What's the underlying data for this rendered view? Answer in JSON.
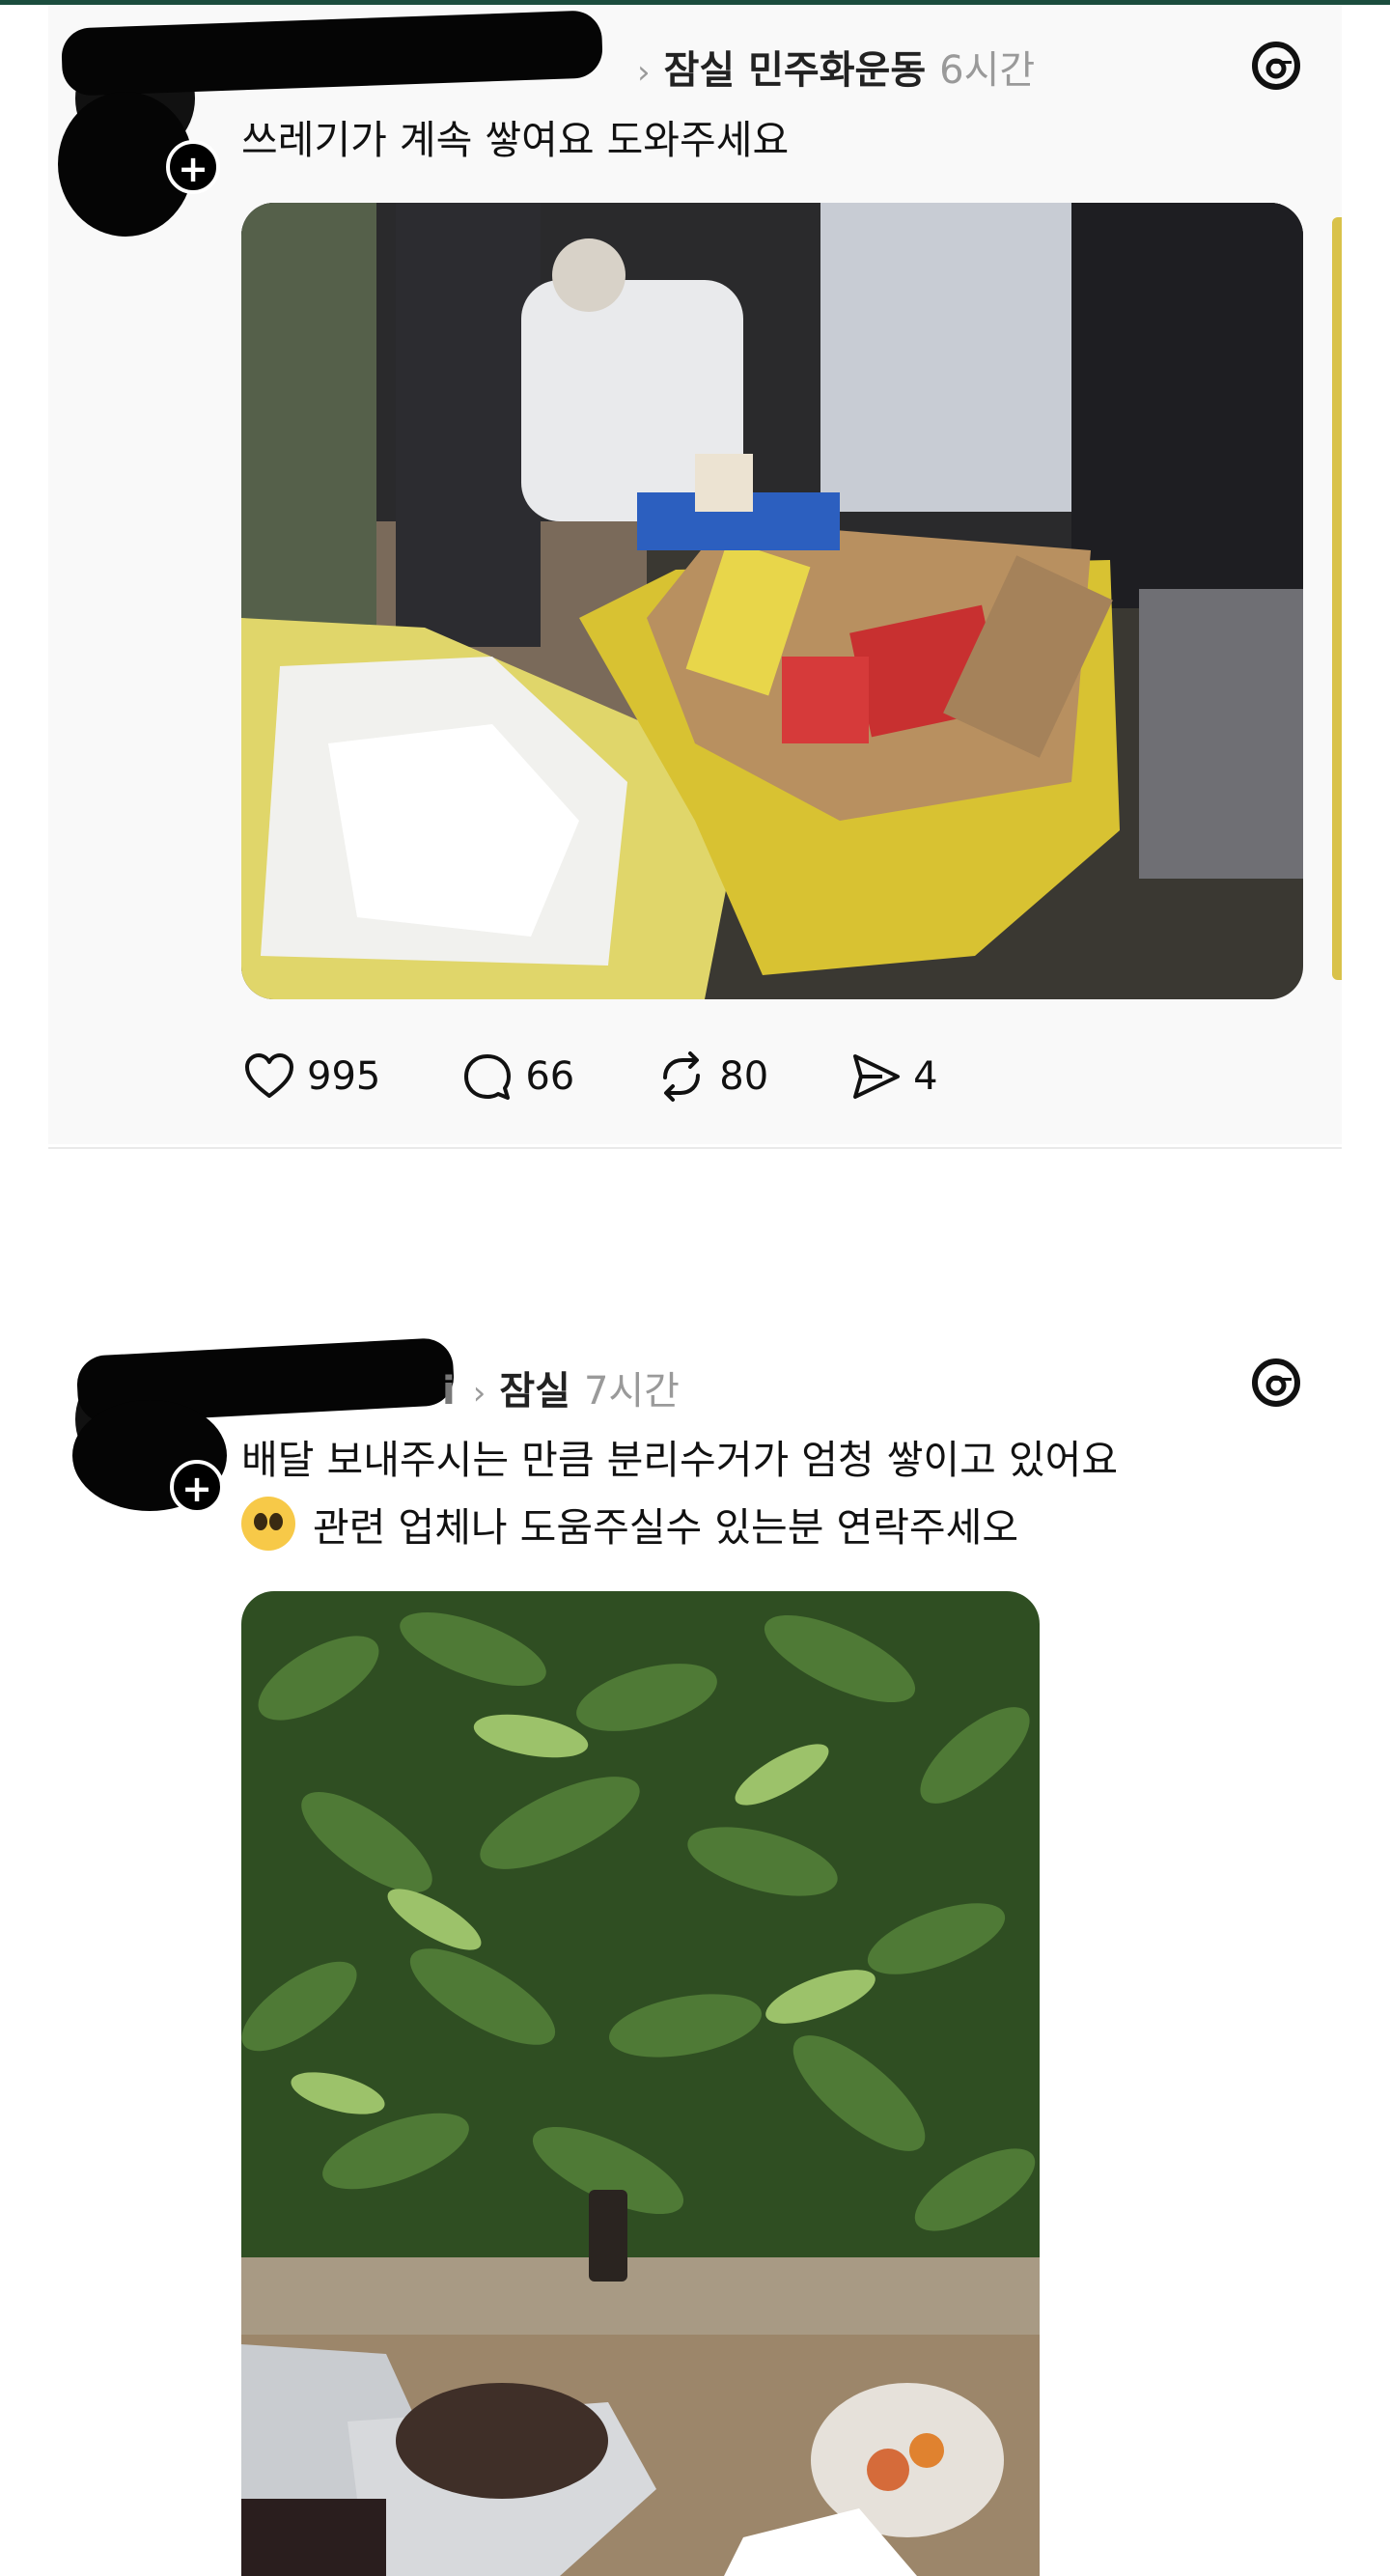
{
  "posts": [
    {
      "location": "잠실 민주화운동",
      "time": "6시간",
      "text_lines": [
        "쓰레기가 계속 쌓여요 도와주세요"
      ],
      "stats": {
        "likes": "995",
        "comments": "66",
        "reposts": "80",
        "shares": "4"
      }
    },
    {
      "username_tail": "i",
      "location": "잠실",
      "time": "7시간",
      "text_lines": [
        "배달 보내주시는 만큼 분리수거가 엄청 쌓이고 있어요",
        "관련 업체나 도움주실수 있는분 연락주세오"
      ]
    }
  ],
  "icons": {
    "app": "threads-icon",
    "like": "heart-icon",
    "comment": "comment-icon",
    "repost": "repost-icon",
    "share": "send-icon",
    "follow": "plus-icon",
    "emoji": "pleading-face-icon"
  },
  "colors": {
    "top_bar": "#1b4d3e",
    "card_bg": "#f9f9f9",
    "muted": "#9a9a9a",
    "bin_yellow": "#d8c232"
  }
}
